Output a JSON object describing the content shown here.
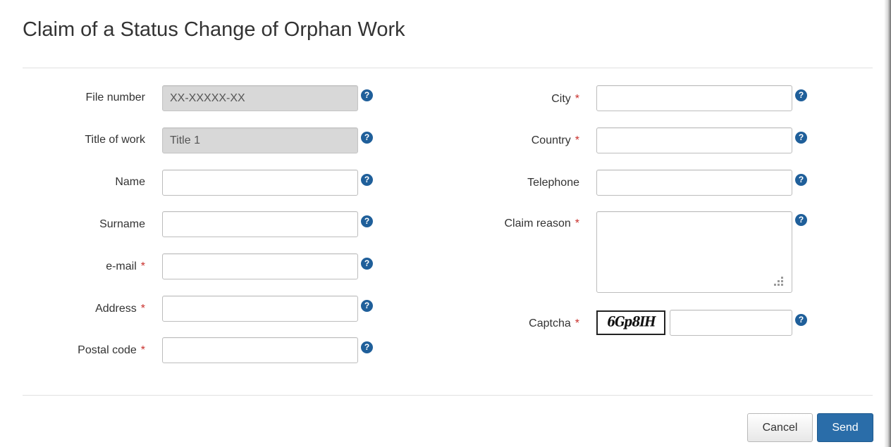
{
  "dialog": {
    "title": "Claim of a Status Change of Orphan Work"
  },
  "help_glyph": "?",
  "required_marker": "*",
  "form_left": {
    "file_number": {
      "label": "File number",
      "value": "XX-XXXXX-XX"
    },
    "title_of_work": {
      "label": "Title of work",
      "value": "Title 1"
    },
    "name": {
      "label": "Name",
      "value": ""
    },
    "surname": {
      "label": "Surname",
      "value": ""
    },
    "email": {
      "label": "e-mail",
      "value": ""
    },
    "address": {
      "label": "Address",
      "value": ""
    },
    "postal_code": {
      "label": "Postal code",
      "value": ""
    }
  },
  "form_right": {
    "city": {
      "label": "City",
      "value": ""
    },
    "country": {
      "label": "Country",
      "value": ""
    },
    "telephone": {
      "label": "Telephone",
      "value": ""
    },
    "claim_reason": {
      "label": "Claim reason",
      "value": ""
    },
    "captcha": {
      "label": "Captcha",
      "image_text": "6Gp8IH",
      "value": ""
    }
  },
  "buttons": {
    "cancel_label": "Cancel",
    "send_label": "Send"
  },
  "colors": {
    "help_icon": "#1f5f9a",
    "required": "#c9302c",
    "send_button": "#2a6da9",
    "readonly_field": "#d8d8d8"
  }
}
